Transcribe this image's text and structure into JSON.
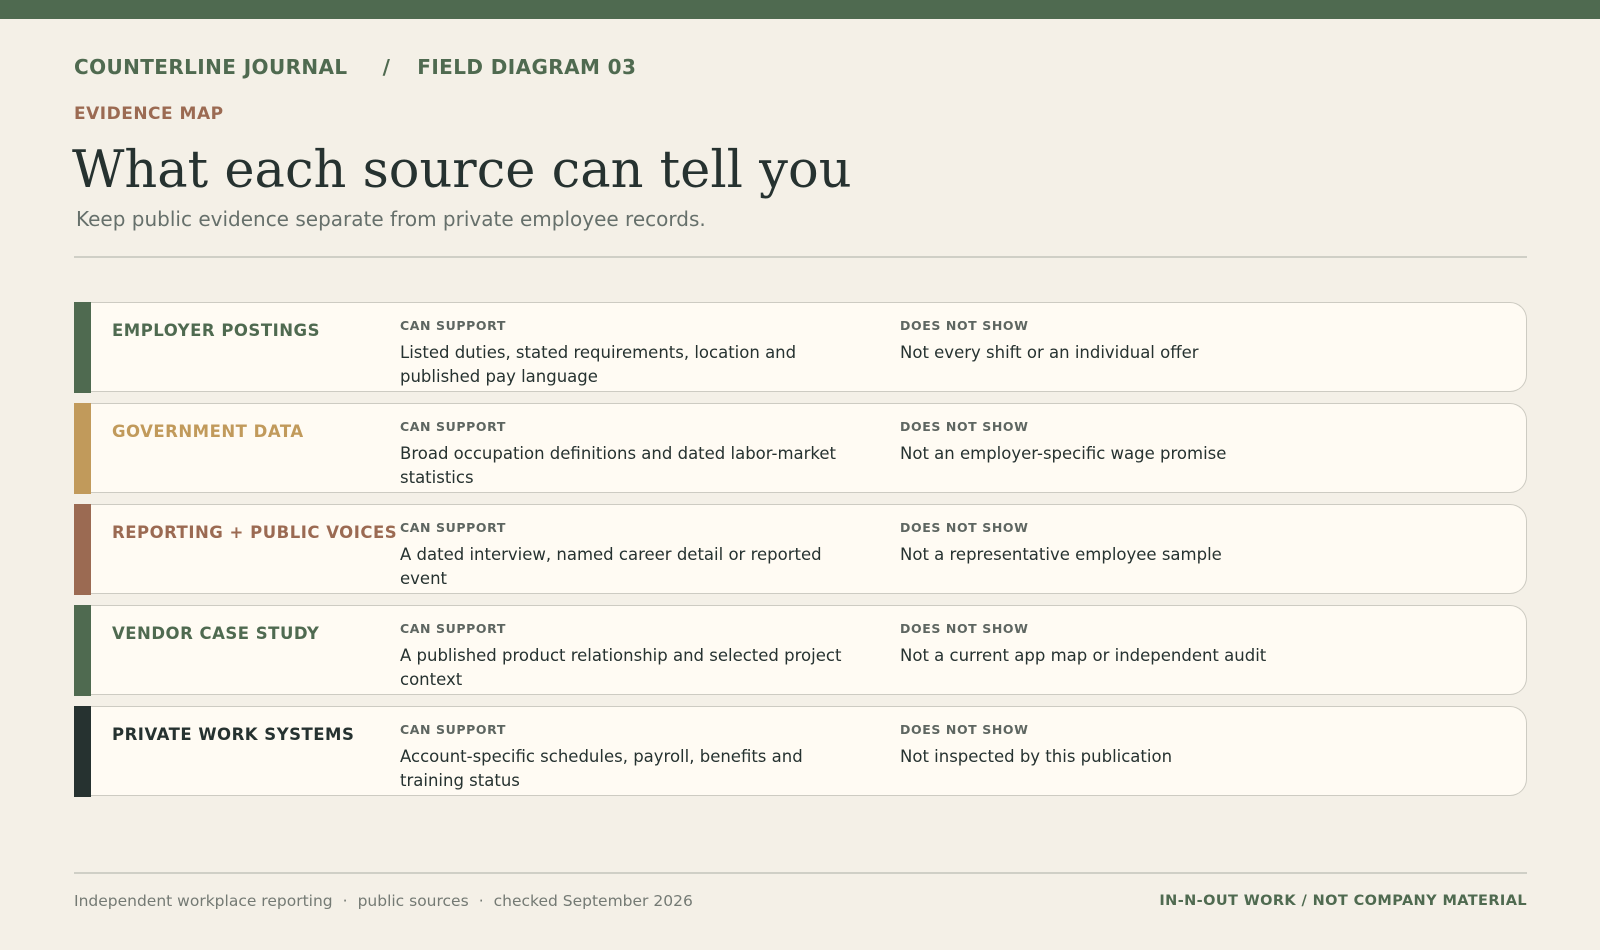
{
  "header": {
    "publication": "COUNTERLINE JOURNAL",
    "separator": "/",
    "diagram_label": "FIELD DIAGRAM 03",
    "section_label": "EVIDENCE MAP",
    "title": "What each source can tell you",
    "subtitle": "Keep public evidence separate from private employee records."
  },
  "column_headers": {
    "can_support": "CAN SUPPORT",
    "does_not_show": "DOES NOT SHOW"
  },
  "colors": {
    "brand_green": "#4f6a50",
    "gold": "#c19a5b",
    "terracotta": "#9b6a52",
    "dark": "#263230"
  },
  "sources": [
    {
      "name": "EMPLOYER POSTINGS",
      "color": "#4f6a50",
      "can_support": "Listed duties, stated requirements, location and published pay language",
      "does_not_show": "Not every shift or an individual offer"
    },
    {
      "name": "GOVERNMENT DATA",
      "color": "#c19a5b",
      "can_support": "Broad occupation definitions and dated labor-market statistics",
      "does_not_show": "Not an employer-specific wage promise"
    },
    {
      "name": "REPORTING + PUBLIC VOICES",
      "color": "#9b6a52",
      "can_support": "A dated interview, named career detail or reported event",
      "does_not_show": "Not a representative employee sample"
    },
    {
      "name": "VENDOR CASE STUDY",
      "color": "#4f6a50",
      "can_support": "A published product relationship and selected project context",
      "does_not_show": "Not a current app map or independent audit"
    },
    {
      "name": "PRIVATE WORK SYSTEMS",
      "color": "#263230",
      "can_support": "Account-specific schedules, payroll, benefits and training status",
      "does_not_show": "Not inspected by this publication"
    }
  ],
  "footer": {
    "note_1": "Independent workplace reporting",
    "note_2": "public sources",
    "note_3": "checked September 2026",
    "dot": "·",
    "right": "IN-N-OUT WORK / NOT COMPANY MATERIAL"
  }
}
